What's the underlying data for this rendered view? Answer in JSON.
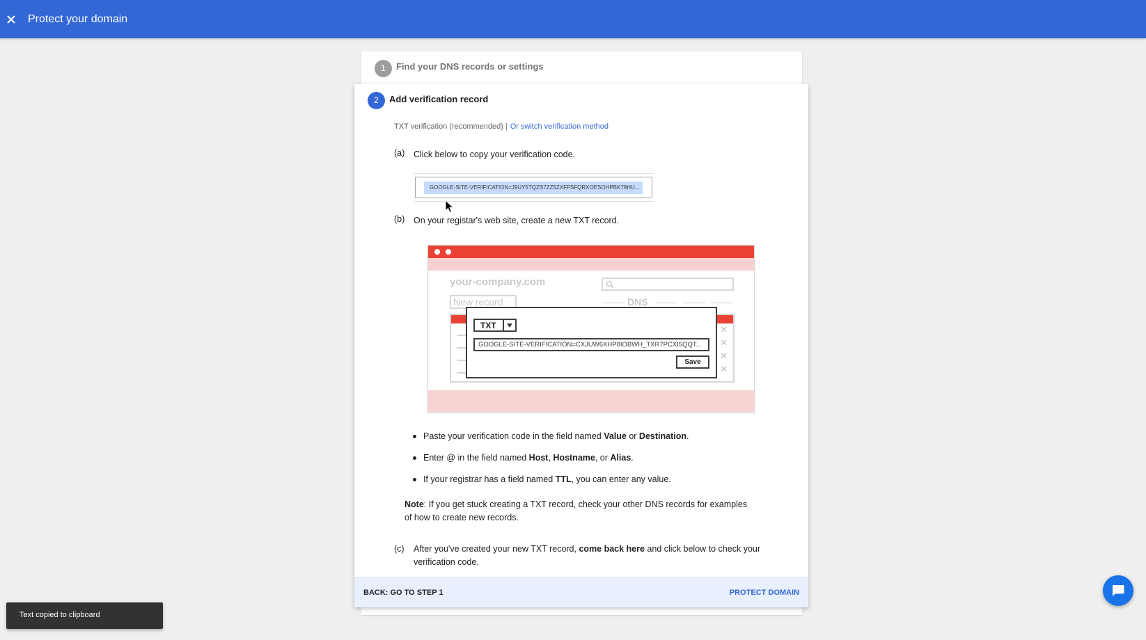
{
  "header": {
    "title": "Protect your domain",
    "close_icon": "close-icon"
  },
  "steps": [
    {
      "number": "1",
      "label": "Find your DNS records or settings"
    },
    {
      "number": "2",
      "label": "Add verification record"
    }
  ],
  "method": {
    "label": "TXT verification (recommended)",
    "separator": "|",
    "switch_link": "Or switch verification method"
  },
  "item_a": {
    "letter": "(a)",
    "text": "Click below to copy your verification code."
  },
  "verification_code": "GOOGLE-SITE-VERIFICATION=J9UY5TQZS7ZZ5ZXFFSFQRXOESOHPBK79HU...",
  "item_b": {
    "letter": "(b)",
    "text": "On your registar's web site, create a new TXT record."
  },
  "illustration": {
    "domain": "your-company.com",
    "new_record": "New record",
    "dns": "DNS",
    "record_type": "TXT",
    "record_value": "GOOGLE-SITE-VERIFICATION=CXJUW6XHP8IOBWH_TXR7PCXI5QQT...",
    "save": "Save",
    "remove_icon": "close-icon",
    "search_icon": "search-icon"
  },
  "bullets": [
    {
      "pre": "Paste your verification code in the field named ",
      "b1": "Value",
      "mid": " or ",
      "b2": "Destination",
      "post": "."
    },
    {
      "pre": "Enter @ in the field named ",
      "b1": "Host",
      "mid1": ", ",
      "b2": "Hostname",
      "mid2": ", or ",
      "b3": "Alias",
      "post": "."
    },
    {
      "pre": "If your registrar has a field named ",
      "b1": "TTL",
      "post": ", you can enter any value."
    }
  ],
  "note": {
    "label": "Note",
    "text": ": If you get stuck creating a TXT record, check your other DNS records for examples of how to create new records."
  },
  "item_c": {
    "letter": "(c)",
    "pre": "After you've created your new TXT record, ",
    "bold": "come back here",
    "post": " and click below to check your verification code."
  },
  "footer": {
    "back": "BACK: GO TO STEP 1",
    "protect": "PROTECT DOMAIN"
  },
  "toast": "Text copied to clipboard",
  "chat": {
    "icon": "chat-icon"
  },
  "colors": {
    "header": "#3367d6",
    "accent": "#3367d6",
    "illustration_red": "#ea4335",
    "footer_bg": "#e8f0fe"
  }
}
